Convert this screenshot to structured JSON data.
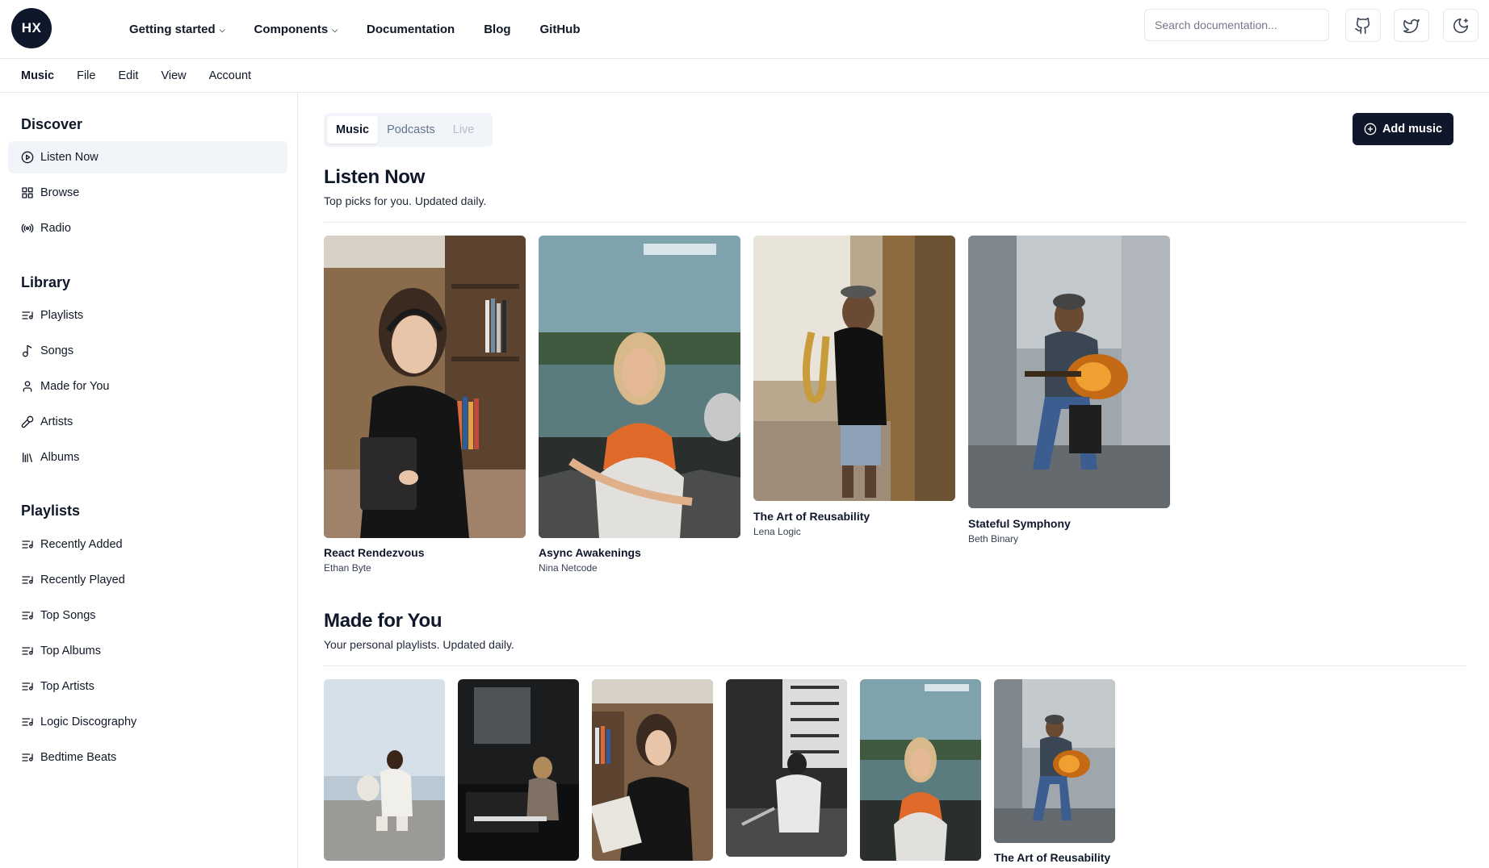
{
  "logo": {
    "text": "HX"
  },
  "nav": {
    "links": [
      {
        "label": "Getting started",
        "has_dropdown": true
      },
      {
        "label": "Components",
        "has_dropdown": true
      },
      {
        "label": "Documentation",
        "has_dropdown": false
      },
      {
        "label": "Blog",
        "has_dropdown": false
      },
      {
        "label": "GitHub",
        "has_dropdown": false
      }
    ],
    "search_placeholder": "Search documentation...",
    "icons": [
      "github-icon",
      "twitter-icon",
      "theme-toggle-icon"
    ]
  },
  "menubar": {
    "items": [
      "Music",
      "File",
      "Edit",
      "View",
      "Account"
    ]
  },
  "sidebar": {
    "discover": {
      "heading": "Discover",
      "items": [
        {
          "label": "Listen Now",
          "icon": "play-circle-icon",
          "active": true
        },
        {
          "label": "Browse",
          "icon": "grid-icon",
          "active": false
        },
        {
          "label": "Radio",
          "icon": "radio-icon",
          "active": false
        }
      ]
    },
    "library": {
      "heading": "Library",
      "items": [
        {
          "label": "Playlists",
          "icon": "playlist-icon"
        },
        {
          "label": "Songs",
          "icon": "music-note-icon"
        },
        {
          "label": "Made for You",
          "icon": "user-icon"
        },
        {
          "label": "Artists",
          "icon": "microphone-icon"
        },
        {
          "label": "Albums",
          "icon": "library-icon"
        }
      ]
    },
    "playlists": {
      "heading": "Playlists",
      "items": [
        {
          "label": "Recently Added",
          "icon": "playlist-icon"
        },
        {
          "label": "Recently Played",
          "icon": "playlist-icon"
        },
        {
          "label": "Top Songs",
          "icon": "playlist-icon"
        },
        {
          "label": "Top Albums",
          "icon": "playlist-icon"
        },
        {
          "label": "Top Artists",
          "icon": "playlist-icon"
        },
        {
          "label": "Logic Discography",
          "icon": "playlist-icon"
        },
        {
          "label": "Bedtime Beats",
          "icon": "playlist-icon"
        }
      ]
    }
  },
  "main": {
    "tabs": [
      {
        "label": "Music",
        "state": "active"
      },
      {
        "label": "Podcasts",
        "state": "normal"
      },
      {
        "label": "Live",
        "state": "disabled"
      }
    ],
    "add_button": "Add music",
    "listen_now": {
      "title": "Listen Now",
      "subtitle": "Top picks for you. Updated daily.",
      "albums": [
        {
          "title": "React Rendezvous",
          "artist": "Ethan Byte"
        },
        {
          "title": "Async Awakenings",
          "artist": "Nina Netcode"
        },
        {
          "title": "The Art of Reusability",
          "artist": "Lena Logic"
        },
        {
          "title": "Stateful Symphony",
          "artist": "Beth Binary"
        }
      ]
    },
    "made_for_you": {
      "title": "Made for You",
      "subtitle": "Your personal playlists. Updated daily.",
      "albums": [
        {
          "title": ""
        },
        {
          "title": ""
        },
        {
          "title": ""
        },
        {
          "title": ""
        },
        {
          "title": ""
        },
        {
          "title": "The Art of Reusability"
        }
      ]
    }
  },
  "colors": {
    "primary": "#0f172a",
    "border": "#e5e7eb",
    "active_bg": "#f1f5f9",
    "muted_text": "#64748b"
  }
}
